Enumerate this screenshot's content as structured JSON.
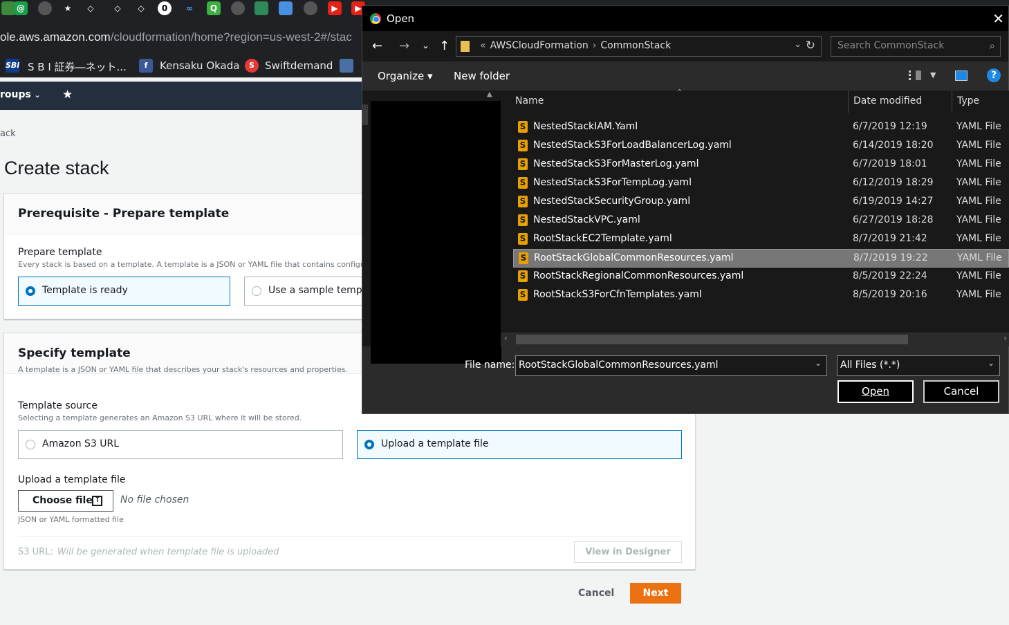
{
  "browser": {
    "url_host": "ole.aws.amazon.com",
    "url_path": "/cloudformation/home?region=us-west-2#/stac",
    "bookmarks": [
      "S B I 証券―ネット...",
      "Kensaku Okada",
      "Swiftdemand"
    ]
  },
  "aws": {
    "nav_groups": "roups",
    "breadcrumb": "ack",
    "page_title": "Create stack",
    "prereq": {
      "title": "Prerequisite - Prepare template",
      "label": "Prepare template",
      "desc": "Every stack is based on a template. A template is a JSON or YAML file that contains configur",
      "options": [
        "Template is ready",
        "Use a sample templat"
      ]
    },
    "specify": {
      "title": "Specify template",
      "desc": "A template is a JSON or YAML file that describes your stack's resources and properties.",
      "source_label": "Template source",
      "source_desc": "Selecting a template generates an Amazon S3 URL where it will be stored.",
      "options": [
        "Amazon S3 URL",
        "Upload a template file"
      ],
      "upload_label": "Upload a template file",
      "choose_file": "Choose file",
      "no_file": "No file chosen",
      "format_hint": "JSON or YAML formatted file",
      "s3_url_label": "S3 URL:",
      "s3_url_value": "Will be generated when template file is uploaded",
      "view_designer": "View in Designer"
    },
    "cancel": "Cancel",
    "next": "Next"
  },
  "dialog": {
    "title": "Open",
    "close": "✕",
    "path": [
      "AWSCloudFormation",
      "CommonStack"
    ],
    "search_placeholder": "Search CommonStack",
    "organize": "Organize ▾",
    "new_folder": "New folder",
    "help": "?",
    "columns": [
      "Name",
      "Date modified",
      "Type"
    ],
    "files": [
      {
        "name": "NestedStackIAM.Yaml",
        "date": "6/7/2019 12:19",
        "type": "YAML File"
      },
      {
        "name": "NestedStackS3ForLoadBalancerLog.yaml",
        "date": "6/14/2019 18:20",
        "type": "YAML File"
      },
      {
        "name": "NestedStackS3ForMasterLog.yaml",
        "date": "6/7/2019 18:01",
        "type": "YAML File"
      },
      {
        "name": "NestedStackS3ForTempLog.yaml",
        "date": "6/12/2019 18:29",
        "type": "YAML File"
      },
      {
        "name": "NestedStackSecurityGroup.yaml",
        "date": "6/19/2019 14:27",
        "type": "YAML File"
      },
      {
        "name": "NestedStackVPC.yaml",
        "date": "6/27/2019 18:28",
        "type": "YAML File"
      },
      {
        "name": "RootStackEC2Template.yaml",
        "date": "8/7/2019 21:42",
        "type": "YAML File"
      },
      {
        "name": "RootStackGlobalCommonResources.yaml",
        "date": "8/7/2019 19:22",
        "type": "YAML File"
      },
      {
        "name": "RootStackRegionalCommonResources.yaml",
        "date": "8/5/2019 22:24",
        "type": "YAML File"
      },
      {
        "name": "RootStackS3ForCfnTemplates.yaml",
        "date": "8/5/2019 20:16",
        "type": "YAML File"
      }
    ],
    "selected_index": 7,
    "file_name_label": "File name:",
    "file_name_value": "RootStackGlobalCommonResources.yaml",
    "filter": "All Files (*.*)",
    "open": "Open",
    "cancel": "Cancel"
  },
  "colors": {
    "aws_orange": "#ec7211",
    "aws_blue": "#0073bb",
    "dialog_bg": "#2b2b2b"
  }
}
